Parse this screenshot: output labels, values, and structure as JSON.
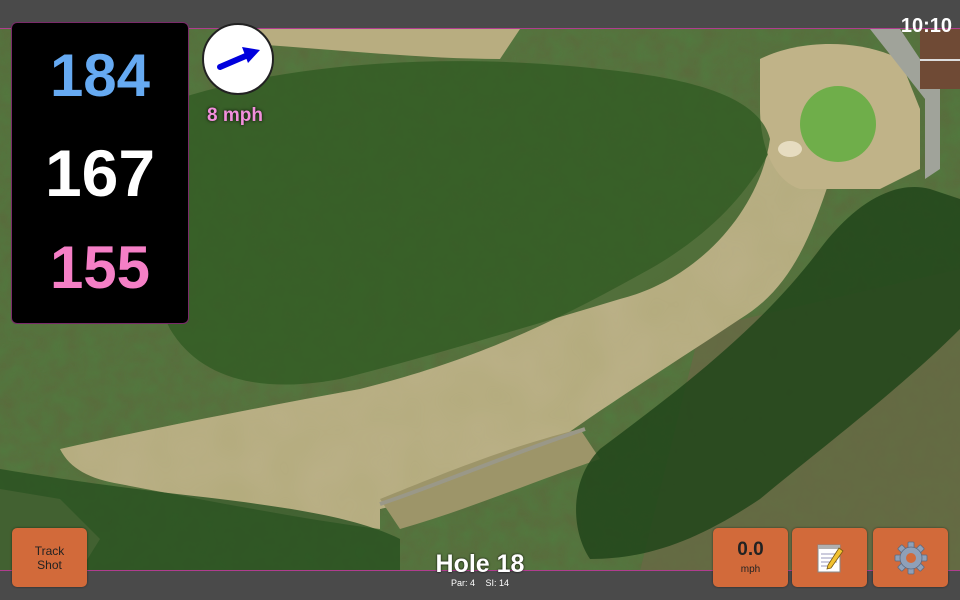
{
  "status_bar": {
    "time": "10:10"
  },
  "yardages": {
    "back": "184",
    "center": "167",
    "front": "155"
  },
  "wind": {
    "speed_label": "8 mph",
    "direction_icon": "wind-arrow-icon"
  },
  "buttons": {
    "track_shot_label": "Track Shot",
    "speed_value": "0.0",
    "speed_unit": "mph",
    "scorecard_icon": "notepad-icon",
    "settings_icon": "gear-icon"
  },
  "hole": {
    "title": "Hole 18",
    "par_label": "Par: 4",
    "si_label": "SI: 14"
  },
  "colors": {
    "back_yardage": "#66aaf2",
    "center_yardage": "#ffffff",
    "front_yardage": "#f57fc6",
    "button": "#d26a3a",
    "wind_text": "#f28fdc"
  }
}
